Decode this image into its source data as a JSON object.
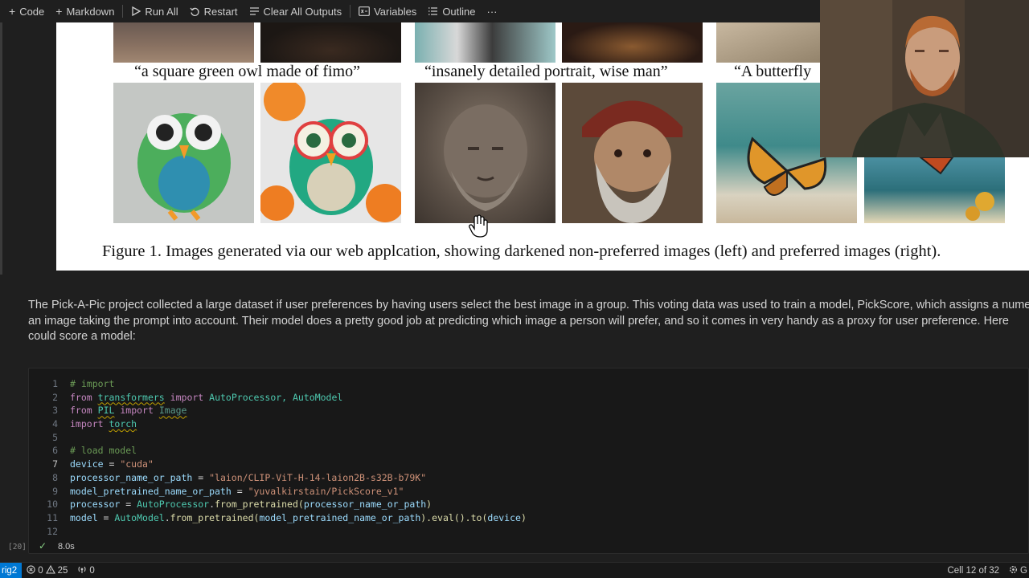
{
  "toolbar": {
    "code_label": "Code",
    "markdown_label": "Markdown",
    "run_all_label": "Run All",
    "restart_label": "Restart",
    "clear_outputs_label": "Clear All Outputs",
    "variables_label": "Variables",
    "outline_label": "Outline",
    "more_label": "···"
  },
  "figure": {
    "captions": [
      "“a square green owl made of fimo”",
      "“insanely detailed portrait, wise man”",
      "“A butterfly"
    ],
    "figure_caption": "Figure 1. Images generated via our web applcation, showing darkened non-preferred images (left) and preferred images (right)."
  },
  "markdown": {
    "lines": [
      "The Pick-A-Pic project collected a large dataset if user preferences by having users select the best image in a group. This voting data was used to train a model, PickScore, which assigns a nume",
      "an image taking the prompt into account. Their model does a pretty good job at predicting which image a person will prefer, and so it comes in very handy as a proxy for user preference. Here",
      "could score a model:"
    ]
  },
  "code_cell": {
    "execution_count": "[20]",
    "status_icon": "check-icon",
    "exec_time": "8.0s",
    "line_numbers": [
      "1",
      "2",
      "3",
      "4",
      "5",
      "6",
      "7",
      "8",
      "9",
      "10",
      "11",
      "12"
    ],
    "active_line": "7",
    "lines": {
      "l1_comment": "# import",
      "l2_from": "from",
      "l2_module": "transformers",
      "l2_import": "import",
      "l2_names": "AutoProcessor, AutoModel",
      "l3_from": "from",
      "l3_module": "PIL",
      "l3_import": "import",
      "l3_names": "Image",
      "l4_import": "import",
      "l4_module": "torch",
      "l6_comment": "# load model",
      "l7_var": "device",
      "l7_eq": " = ",
      "l7_str": "\"cuda\"",
      "l8_var": "processor_name_or_path",
      "l8_eq": " = ",
      "l8_str": "\"laion/CLIP-ViT-H-14-laion2B-s32B-b79K\"",
      "l9_var": "model_pretrained_name_or_path",
      "l9_eq": " = ",
      "l9_str": "\"yuvalkirstain/PickScore_v1\"",
      "l10_var": "processor",
      "l10_eq": " = ",
      "l10_cls": "AutoProcessor",
      "l10_dot": ".",
      "l10_fn": "from_pretrained",
      "l10_open": "(",
      "l10_arg": "processor_name_or_path",
      "l10_close": ")",
      "l11_var": "model",
      "l11_eq": " = ",
      "l11_cls": "AutoModel",
      "l11_dot": ".",
      "l11_fn": "from_pretrained",
      "l11_open": "(",
      "l11_arg": "model_pretrained_name_or_path",
      "l11_mid": ").",
      "l11_fn2": "eval",
      "l11_mid2": "().",
      "l11_fn3": "to",
      "l11_open2": "(",
      "l11_arg2": "device",
      "l11_close": ")"
    }
  },
  "statusbar": {
    "remote_label": "rig2",
    "errors": "0",
    "warnings": "25",
    "ports": "0",
    "cell_position": "Cell 12 of 32",
    "right_edge": "G"
  },
  "colors": {
    "background": "#1f1f1f",
    "accent": "#0078d4",
    "success": "#89d185"
  }
}
